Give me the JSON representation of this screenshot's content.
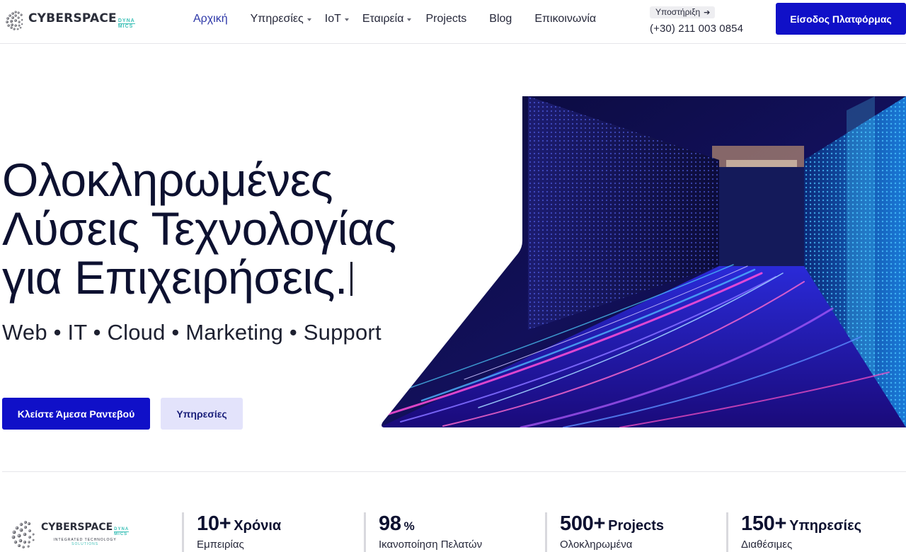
{
  "brand": {
    "name": "CYBERSPACE",
    "suffix_top": "DYNA",
    "suffix_bottom": "MICS",
    "tagline": "INTEGRATED TECHNOLOGY",
    "tagline2": "SOLUTIONS"
  },
  "nav": {
    "items": [
      {
        "label": "Αρχική",
        "active": true,
        "dropdown": false
      },
      {
        "label": "Υπηρεσίες",
        "active": false,
        "dropdown": true
      },
      {
        "label": "IoT",
        "active": false,
        "dropdown": true
      },
      {
        "label": "Εταιρεία",
        "active": false,
        "dropdown": true
      },
      {
        "label": "Projects",
        "active": false,
        "dropdown": false
      },
      {
        "label": "Blog",
        "active": false,
        "dropdown": false
      },
      {
        "label": "Επικοινωνία",
        "active": false,
        "dropdown": false
      }
    ]
  },
  "support": {
    "label": "Υποστήριξη",
    "icon": "arrow-right-icon",
    "phone": "(+30) 211 003 0854"
  },
  "header": {
    "login_label": "Είσοδος Πλατφόρμας"
  },
  "hero": {
    "title_line1": "Ολοκληρωμένες",
    "title_line2": "Λύσεις Τεχνολογίας",
    "title_line3": "για Επιχειρήσεις.",
    "subtitle": "Web • IT • Cloud • Marketing • Support",
    "primary_cta": "Κλείστε Άμεσα Ραντεβού",
    "secondary_cta": "Υπηρεσίες"
  },
  "stats": [
    {
      "number": "10+",
      "unit": "Χρόνια",
      "desc": "Εμπειρίας"
    },
    {
      "number": "98",
      "unit": "%",
      "desc": "Ικανοποίηση Πελατών"
    },
    {
      "number": "500+",
      "unit": "Projects",
      "desc": "Ολοκληρωμένα"
    },
    {
      "number": "150+",
      "unit": "Υπηρεσίες",
      "desc": "Διαθέσιμες"
    }
  ],
  "colors": {
    "primary": "#1010c8",
    "secondary_bg": "#e3e3fb",
    "nav_active": "#2d37a8",
    "logo_accent": "#3cc0b7",
    "heading": "#0d1130"
  }
}
